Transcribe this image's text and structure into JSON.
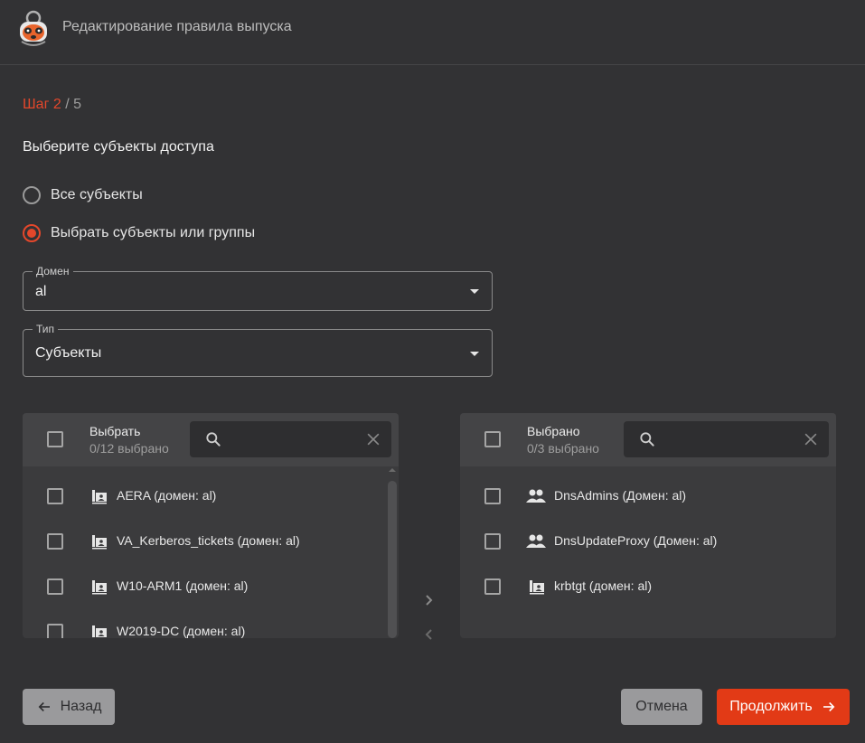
{
  "header": {
    "title": "Редактирование правила выпуска",
    "logo_icon": "raccoon-logo-icon"
  },
  "step": {
    "label": "Шаг 2",
    "separator": " / ",
    "total": "5"
  },
  "section_title": "Выберите субъекты доступа",
  "radios": [
    {
      "label": "Все субъекты",
      "checked": false
    },
    {
      "label": "Выбрать субъекты или группы",
      "checked": true
    }
  ],
  "domain_select": {
    "legend": "Домен",
    "value": "al"
  },
  "type_select": {
    "legend": "Тип",
    "value": "Субъекты"
  },
  "left_panel": {
    "title": "Выбрать",
    "count": "0/12 выбрано",
    "search_placeholder": "",
    "items": [
      {
        "label": "AERA (домен: al)",
        "icon": "computer-account-icon"
      },
      {
        "label": "VA_Kerberos_tickets (домен: al)",
        "icon": "computer-account-icon"
      },
      {
        "label": "W10-ARM1 (домен: al)",
        "icon": "computer-account-icon"
      },
      {
        "label": "W2019-DC (домен: al)",
        "icon": "computer-account-icon"
      }
    ]
  },
  "right_panel": {
    "title": "Выбрано",
    "count": "0/3 выбрано",
    "search_placeholder": "",
    "items": [
      {
        "label": "DnsAdmins (Домен: al)",
        "icon": "group-icon"
      },
      {
        "label": "DnsUpdateProxy (Домен: al)",
        "icon": "group-icon"
      },
      {
        "label": "krbtgt (домен: al)",
        "icon": "computer-account-icon"
      }
    ]
  },
  "buttons": {
    "back": "Назад",
    "cancel": "Отмена",
    "next": "Продолжить"
  },
  "colors": {
    "accent": "#e4472b",
    "primary_button": "#e23a16",
    "background": "#323234",
    "panel": "#3b3b3d"
  }
}
